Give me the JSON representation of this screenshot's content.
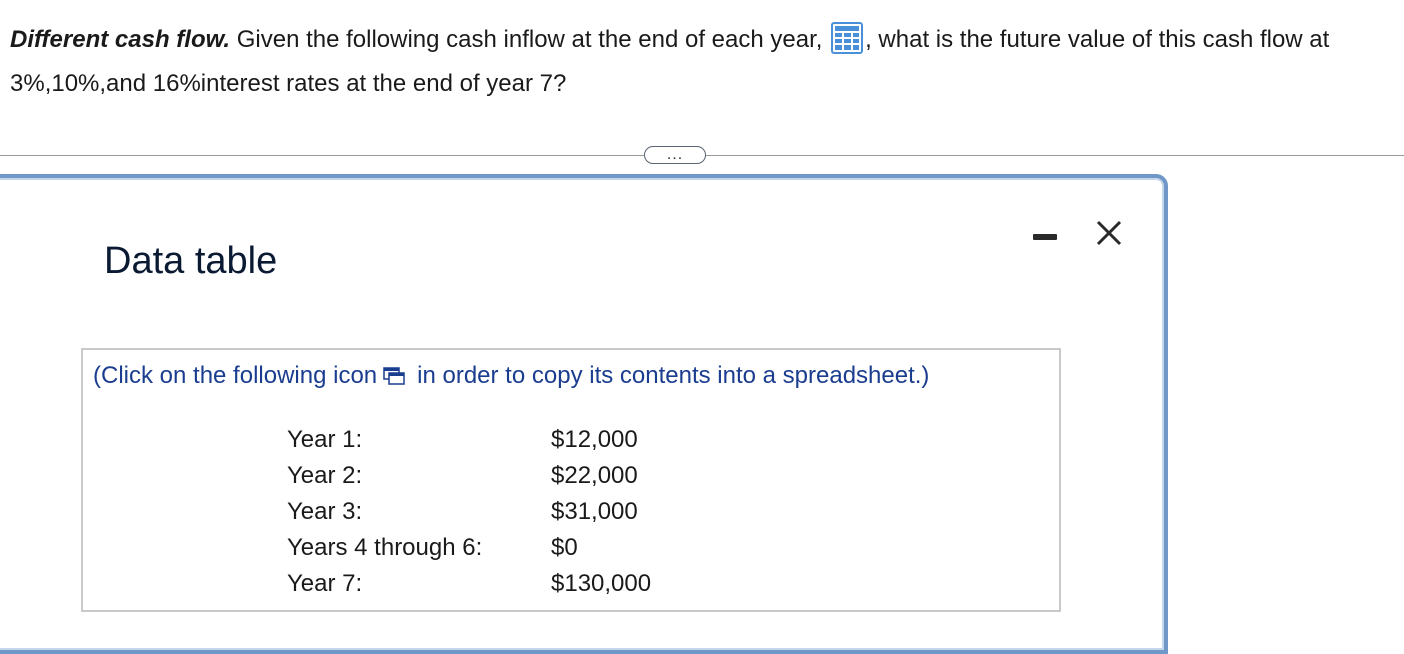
{
  "question": {
    "title": "Different cash flow.",
    "text_before_icon": " Given the following cash inflow at the end of each year, ",
    "text_after_icon": ", what is the future value of this cash flow at 3%,10%,and 16%interest rates at the end of year 7?",
    "icon": "grid-icon"
  },
  "expand_button": {
    "label": "..."
  },
  "dialog": {
    "title": "Data table",
    "minimize_icon": "minimize-icon",
    "close_icon": "close-icon",
    "hint_before_icon": "(Click on the following icon",
    "hint_after_icon": "in order to copy its contents into a spreadsheet.)",
    "copy_icon": "copy-icon",
    "rows": [
      {
        "label": "Year 1:",
        "value": "$12,000"
      },
      {
        "label": "Year 2:",
        "value": "$22,000"
      },
      {
        "label": "Year 3:",
        "value": "$31,000"
      },
      {
        "label": "Years 4 through 6:",
        "value": "$0"
      },
      {
        "label": "Year 7:",
        "value": "$130,000"
      }
    ]
  },
  "colors": {
    "accent": "#1a3d8f",
    "dialog_border": "#6f97c8",
    "grid_icon": "#4a90d9"
  }
}
